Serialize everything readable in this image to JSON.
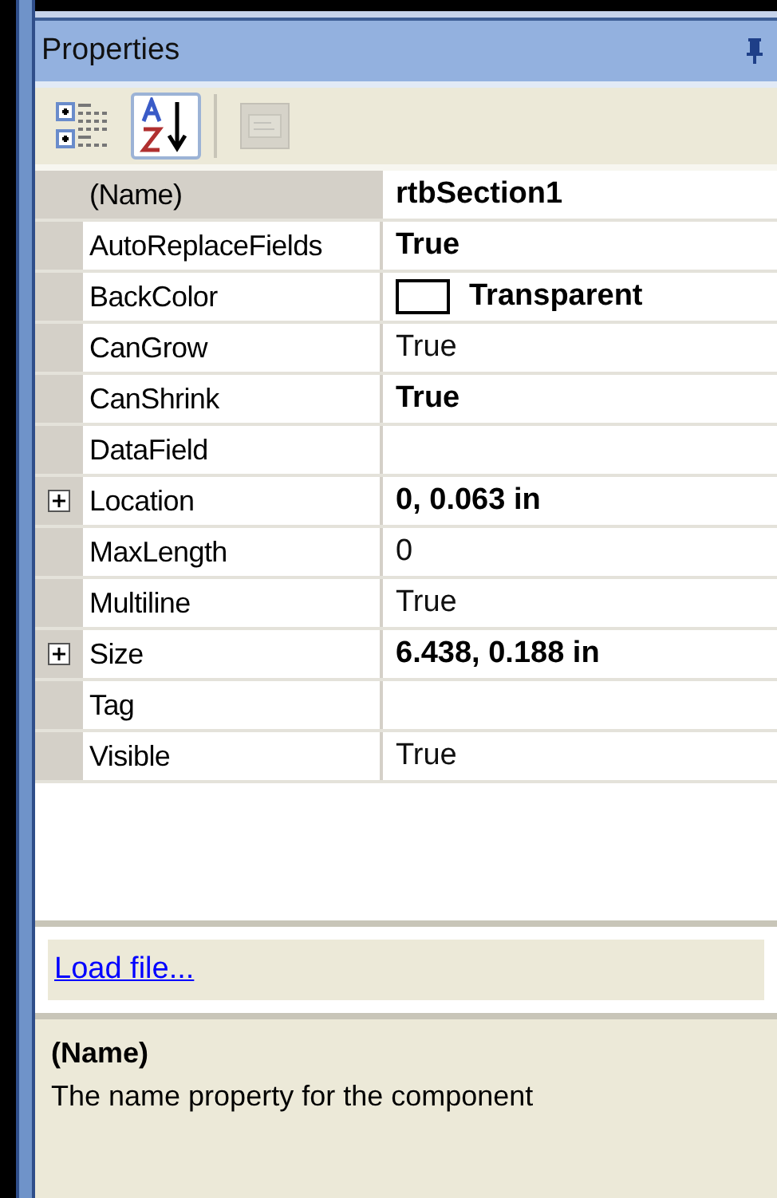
{
  "panel": {
    "title": "Properties"
  },
  "toolbar": [
    {
      "kind": "categorized",
      "selected": false,
      "disabled": false
    },
    {
      "kind": "alphabetical",
      "selected": true,
      "disabled": false
    },
    {
      "kind": "pages",
      "selected": false,
      "disabled": true
    }
  ],
  "properties": [
    {
      "name": "(Name)",
      "value": "rtbSection1",
      "kind": "text",
      "bold": true,
      "expandable": false,
      "selected": true
    },
    {
      "name": "AutoReplaceFields",
      "value": "True",
      "kind": "text",
      "bold": true,
      "expandable": false,
      "selected": false
    },
    {
      "name": "BackColor",
      "value": "Transparent",
      "kind": "color",
      "bold": true,
      "expandable": false,
      "selected": false
    },
    {
      "name": "CanGrow",
      "value": "True",
      "kind": "text",
      "bold": false,
      "expandable": false,
      "selected": false
    },
    {
      "name": "CanShrink",
      "value": "True",
      "kind": "text",
      "bold": true,
      "expandable": false,
      "selected": false
    },
    {
      "name": "DataField",
      "kind": "text",
      "expandable": false,
      "selected": false
    },
    {
      "name": "Location",
      "value": "0, 0.063 in",
      "kind": "text",
      "bold": true,
      "expandable": true,
      "selected": false
    },
    {
      "name": "MaxLength",
      "value": "0",
      "kind": "text",
      "bold": false,
      "expandable": false,
      "selected": false
    },
    {
      "name": "Multiline",
      "value": "True",
      "kind": "text",
      "bold": false,
      "expandable": false,
      "selected": false
    },
    {
      "name": "Size",
      "value": "6.438, 0.188 in",
      "kind": "text",
      "bold": true,
      "expandable": true,
      "selected": false
    },
    {
      "name": "Tag",
      "kind": "text",
      "expandable": false,
      "selected": false
    },
    {
      "name": "Visible",
      "value": "True",
      "kind": "text",
      "bold": false,
      "expandable": false,
      "selected": false
    }
  ],
  "commands": [
    {
      "label": "Load file..."
    }
  ],
  "description": {
    "title": "(Name)",
    "text": "The name property for the component"
  }
}
